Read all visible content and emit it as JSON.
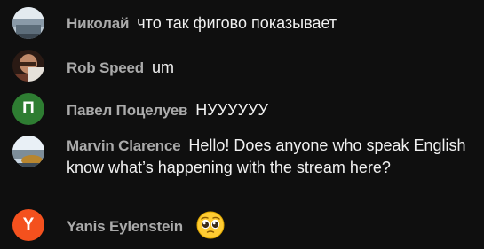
{
  "messages": [
    {
      "author": "Николай",
      "text": "что так фигово показывает",
      "avatar": {
        "type": "photo",
        "icon": "user-photo-icon"
      }
    },
    {
      "author": "Rob Speed",
      "text": "um",
      "avatar": {
        "type": "photo",
        "icon": "user-photo-icon"
      }
    },
    {
      "author": "Павел Поцелуев",
      "text": "НУУУУУУ",
      "avatar": {
        "type": "letter",
        "letter": "П",
        "color": "#2e7d32"
      }
    },
    {
      "author": "Marvin Clarence",
      "text": "Hello! Does anyone who speak English know what’s happening with the stream here?",
      "avatar": {
        "type": "photo",
        "icon": "user-photo-icon"
      }
    },
    {
      "author": "Yanis Eylenstein",
      "text": "",
      "emoji": "pleading-face-emoji",
      "avatar": {
        "type": "letter",
        "letter": "Y",
        "color": "#f4511e"
      }
    }
  ],
  "colors": {
    "background": "#0f0f0f",
    "author": "#aaaaaa",
    "message": "#f1f1f1"
  }
}
